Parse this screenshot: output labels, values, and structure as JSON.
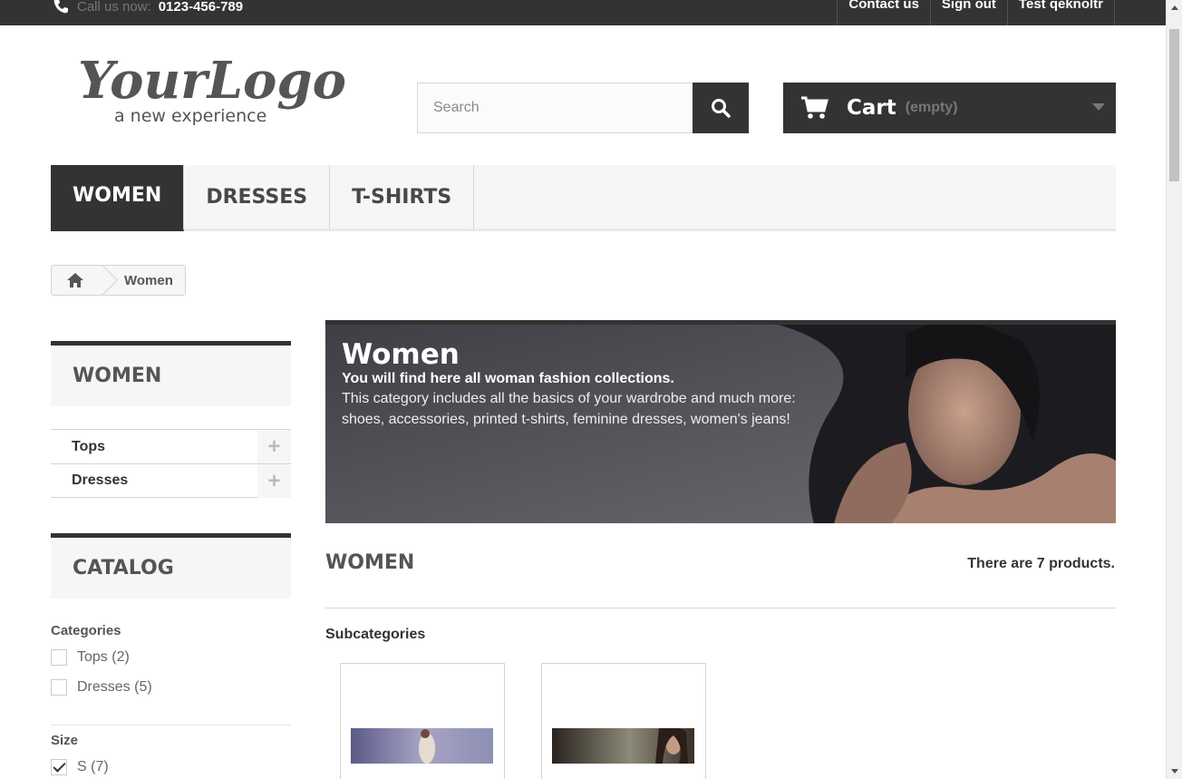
{
  "topbar": {
    "call_prefix": "Call us now:",
    "phone": "0123-456-789",
    "links": [
      "Contact us",
      "Sign out",
      "Test qeknoltr"
    ]
  },
  "logo": {
    "main": "YourLogo",
    "tagline": "a new experience"
  },
  "search": {
    "placeholder": "Search"
  },
  "cart": {
    "label": "Cart",
    "qty": "(empty)"
  },
  "menu": {
    "items": [
      "WOMEN",
      "DRESSES",
      "T-SHIRTS"
    ]
  },
  "breadcrumb": {
    "current": "Women"
  },
  "sidebar": {
    "category_title": "WOMEN",
    "tree": [
      {
        "label": "Tops"
      },
      {
        "label": "Dresses"
      }
    ],
    "catalog_title": "CATALOG",
    "filters": {
      "categories_title": "Categories",
      "categories": [
        {
          "label": "Tops (2)",
          "checked": false
        },
        {
          "label": "Dresses (5)",
          "checked": false
        }
      ],
      "size_title": "Size",
      "sizes": [
        {
          "label": "S (7)",
          "checked": true
        }
      ]
    }
  },
  "banner": {
    "title": "Women",
    "subtitle": "You will find here all woman fashion collections.",
    "description": "This category includes all the basics of your wardrobe and much more: shoes, accessories, printed t-shirts, feminine dresses, women's jeans!"
  },
  "content": {
    "heading": "WOMEN",
    "product_count": "There are 7 products.",
    "subcategories_title": "Subcategories"
  },
  "colors": {
    "dark": "#333333",
    "light_bg": "#f6f6f6",
    "border": "#d6d4d4"
  }
}
